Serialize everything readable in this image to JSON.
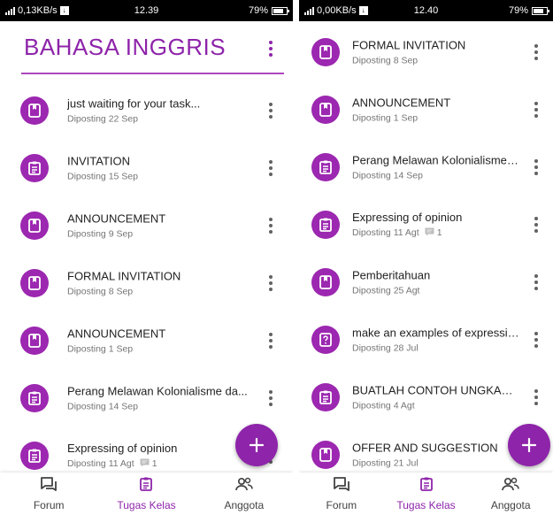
{
  "colors": {
    "accent": "#8e24aa",
    "avatar": "#9c27b0",
    "subtext": "#757575",
    "text": "#222222"
  },
  "left": {
    "status": {
      "network": "0,13KB/s",
      "time": "12.39",
      "battery": "79%",
      "battery_level": 0.79
    },
    "header": {
      "title": "BAHASA INGGRIS"
    },
    "items": [
      {
        "icon": "book-icon",
        "title": "just waiting for your task...",
        "subtitle": "Diposting 22 Sep",
        "comments": ""
      },
      {
        "icon": "assignment-icon",
        "title": "INVITATION",
        "subtitle": "Diposting 15 Sep",
        "comments": ""
      },
      {
        "icon": "book-icon",
        "title": "ANNOUNCEMENT",
        "subtitle": "Diposting 9 Sep",
        "comments": ""
      },
      {
        "icon": "book-icon",
        "title": "FORMAL INVITATION",
        "subtitle": "Diposting 8 Sep",
        "comments": ""
      },
      {
        "icon": "book-icon",
        "title": "ANNOUNCEMENT",
        "subtitle": "Diposting 1 Sep",
        "comments": ""
      },
      {
        "icon": "assignment-icon",
        "title": "Perang Melawan Kolonialisme da...",
        "subtitle": "Diposting 14 Sep",
        "comments": ""
      },
      {
        "icon": "assignment-icon",
        "title": "Expressing of opinion",
        "subtitle": "Diposting 11 Agt",
        "comments": "1"
      }
    ],
    "nav": [
      {
        "label": "Forum"
      },
      {
        "label": "Tugas Kelas"
      },
      {
        "label": "Anggota"
      }
    ]
  },
  "right": {
    "status": {
      "network": "0,00KB/s",
      "time": "12.40",
      "battery": "79%",
      "battery_level": 0.79
    },
    "items": [
      {
        "icon": "book-icon",
        "title": "FORMAL INVITATION",
        "subtitle": "Diposting 8 Sep",
        "comments": ""
      },
      {
        "icon": "book-icon",
        "title": "ANNOUNCEMENT",
        "subtitle": "Diposting 1 Sep",
        "comments": ""
      },
      {
        "icon": "assignment-icon",
        "title": "Perang Melawan Kolonialisme da...",
        "subtitle": "Diposting 14 Sep",
        "comments": ""
      },
      {
        "icon": "assignment-icon",
        "title": "Expressing of opinion",
        "subtitle": "Diposting 11 Agt",
        "comments": "1"
      },
      {
        "icon": "book-icon",
        "title": "Pemberitahuan",
        "subtitle": "Diposting 25 Agt",
        "comments": ""
      },
      {
        "icon": "question-icon",
        "title": "make an examples of expressing...",
        "subtitle": "Diposting 28 Jul",
        "comments": ""
      },
      {
        "icon": "assignment-icon",
        "title": "BUATLAH CONTOH UNGKAPAN...",
        "subtitle": "Diposting 4 Agt",
        "comments": ""
      },
      {
        "icon": "book-icon",
        "title": "OFFER AND SUGGESTION",
        "subtitle": "Diposting 21 Jul",
        "comments": ""
      }
    ],
    "nav": [
      {
        "label": "Forum"
      },
      {
        "label": "Tugas Kelas"
      },
      {
        "label": "Anggota"
      }
    ]
  },
  "active_tab": 1
}
